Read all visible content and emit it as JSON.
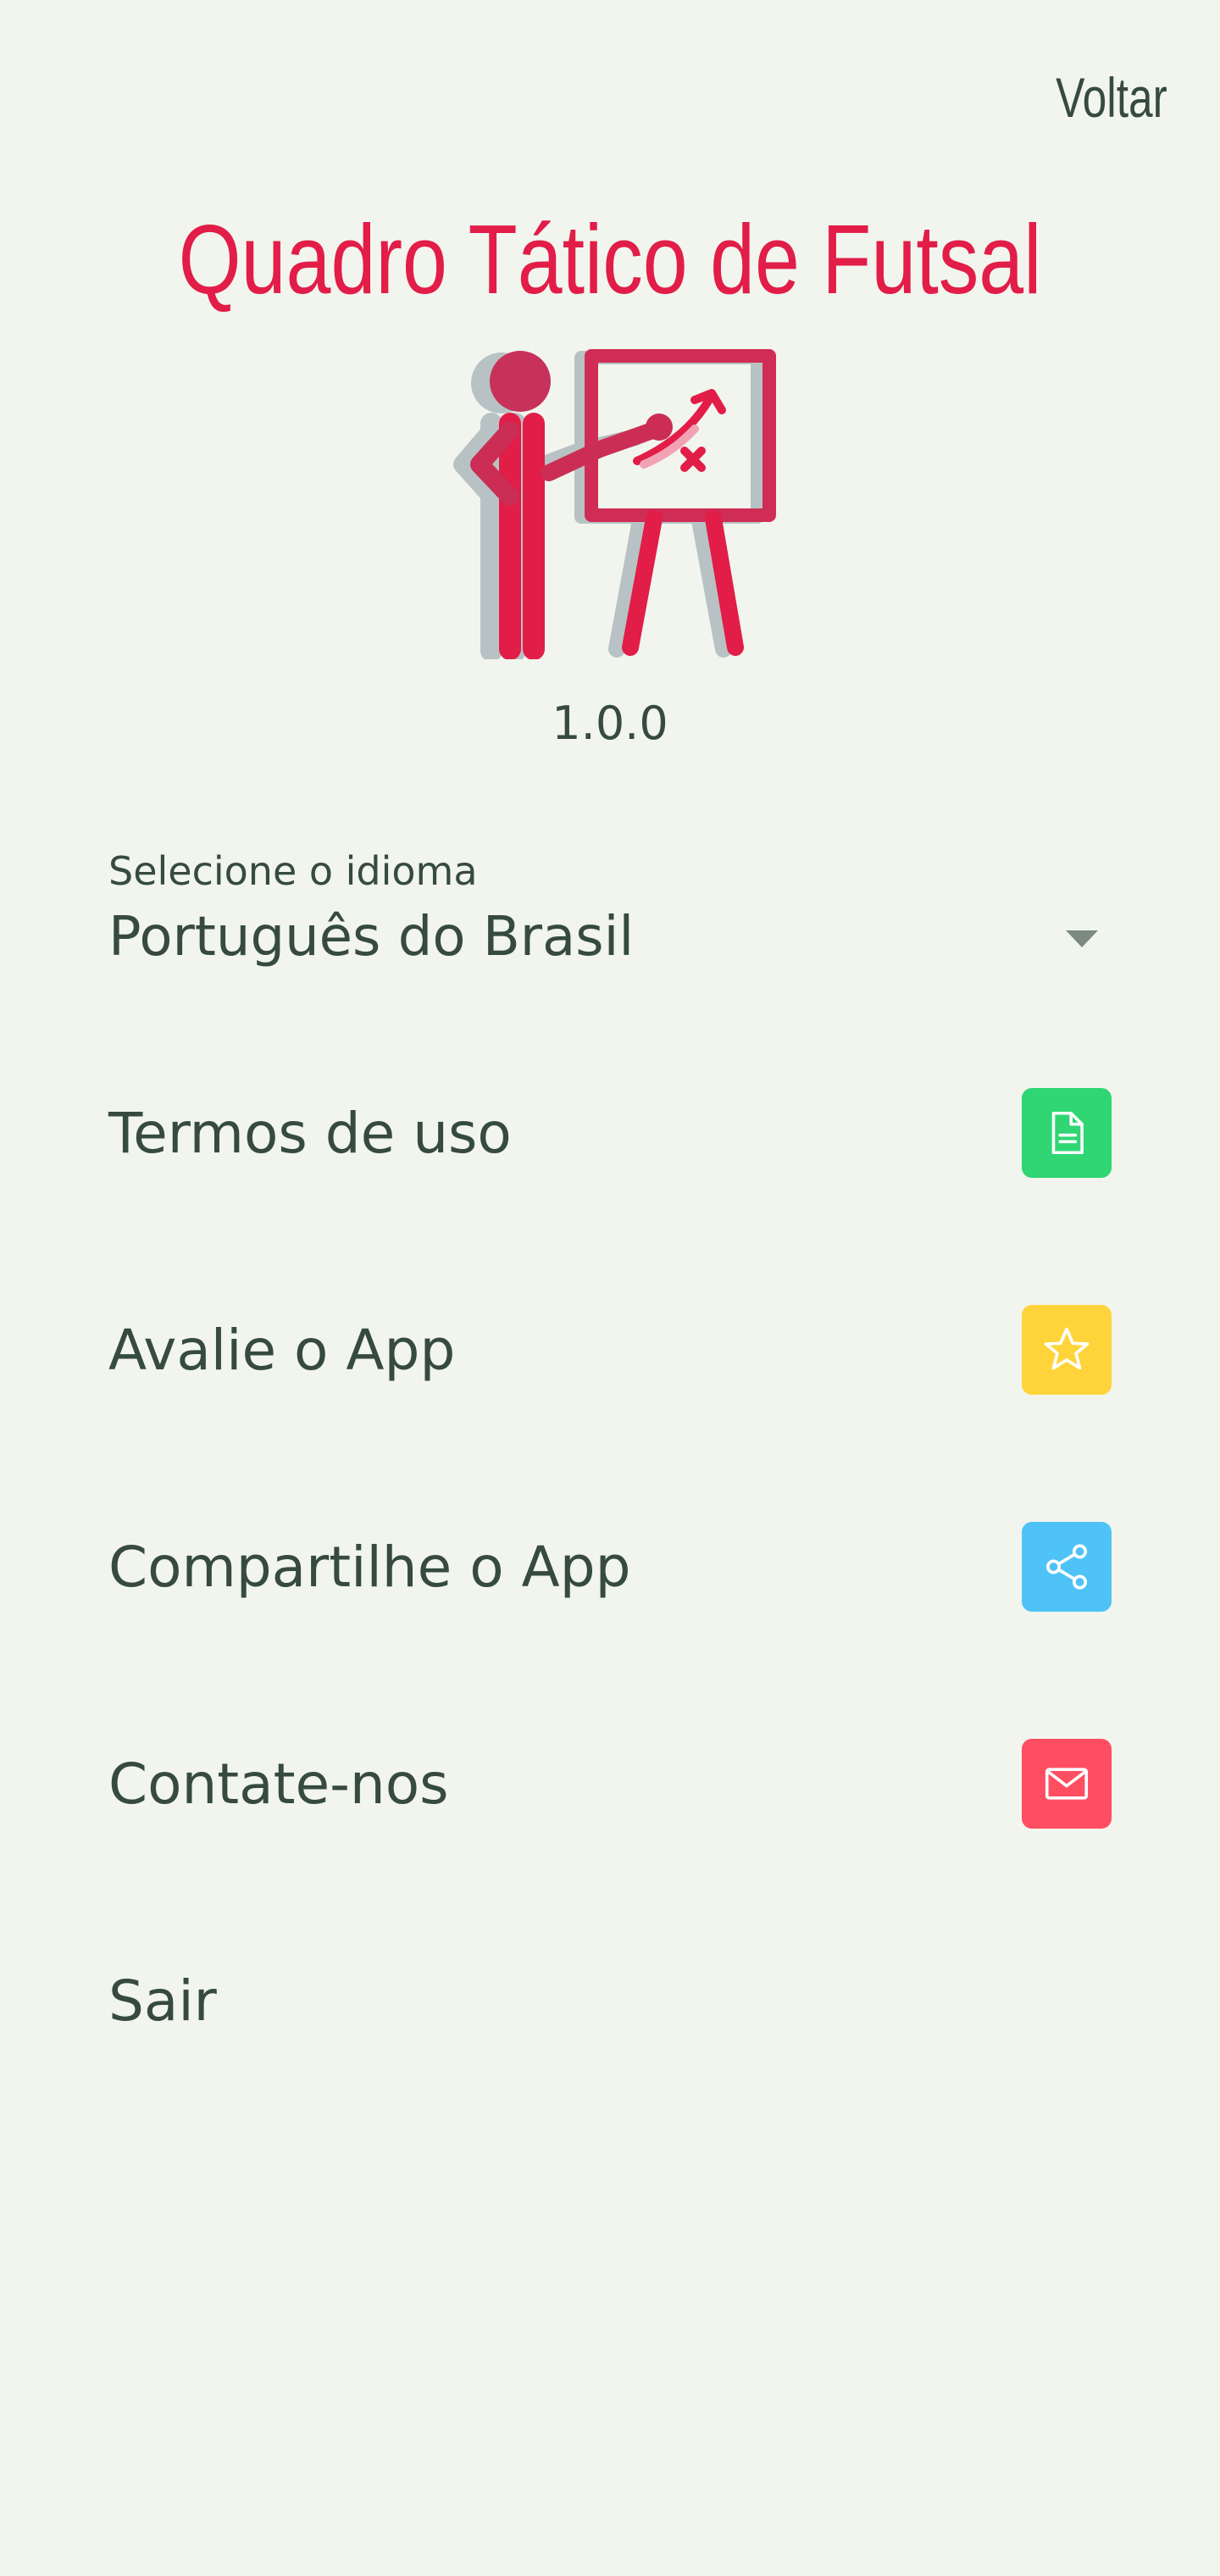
{
  "header": {
    "back_label": "Voltar"
  },
  "app": {
    "title": "Quadro Tático de Futsal",
    "version": "1.0.0",
    "logo_icon": "coach-tactics-board-icon"
  },
  "language": {
    "label": "Selecione o idioma",
    "selected": "Português do Brasil",
    "caret_icon": "caret-down-icon"
  },
  "menu": [
    {
      "label": "Termos de uso",
      "icon": "document-icon",
      "color": "#2fd673"
    },
    {
      "label": "Avalie o App",
      "icon": "star-icon",
      "color": "#ffd43b"
    },
    {
      "label": "Compartilhe o App",
      "icon": "share-icon",
      "color": "#4fc3f7"
    },
    {
      "label": "Contate-nos",
      "icon": "mail-icon",
      "color": "#ff4d62"
    },
    {
      "label": "Sair"
    }
  ],
  "colors": {
    "background": "#f1f5ee",
    "title": "#e11d48",
    "text": "#364a40"
  }
}
